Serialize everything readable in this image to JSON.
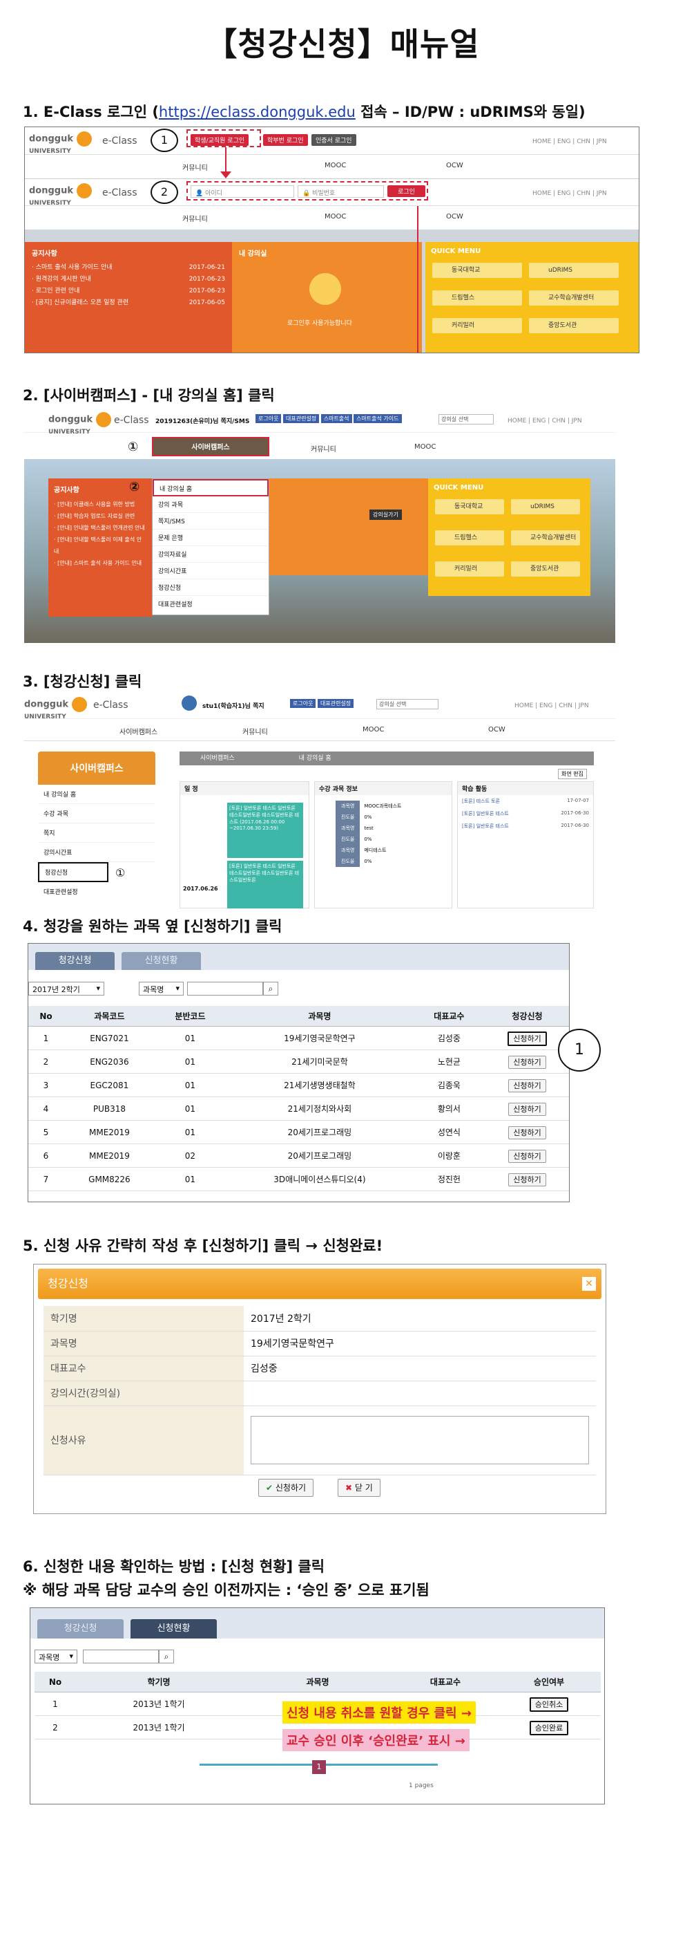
{
  "doc_title": "【청강신청】매뉴얼",
  "steps": {
    "s1_prefix": "1. E-Class 로그인 (",
    "s1_link": "https://eclass.dongguk.edu",
    "s1_suffix": " 접속 – ID/PW : uDRIMS와 동일)",
    "s2": "2. [사이버캠퍼스] - [내 강의실 홈] 클릭",
    "s3": "3. [청강신청] 클릭",
    "s4": "4. 청강을 원하는 과목 옆 [신청하기] 클릭",
    "s5_prefix": "5. 신청 사유 간략히 작성 후 [신청하기] 클릭 → ",
    "s5_bold": "신청완료!",
    "s6a": "6. 신청한 내용 확인하는 방법 : [신청 현황] 클릭",
    "s6b": "※ 해당 과목 담당 교수의 승인 이전까지는 : ‘승인 중’ 으로 표기됨"
  },
  "brand": {
    "logo_top": "dongguk",
    "logo_bottom": "UNIVERSITY",
    "eclass": "e-Class"
  },
  "topnav": "HOME  |  ENG  |  CHN  |  JPN",
  "shot1": {
    "login_buttons": [
      "학생/교직원 로그인",
      "학부번 로그인",
      "인증서 로그인"
    ],
    "id_placeholder": "아이디",
    "pw_placeholder": "비밀번호",
    "login_btn": "로그인",
    "menu": [
      "커뮤니티",
      "MOOC",
      "OCW"
    ],
    "notice_title": "공지사항",
    "notices": [
      "· 스마트 출석 사용 가이드 안내",
      "· 원격강의 게시판 안내",
      "· 로그인 관련 안내",
      "· [공지] 신규이클래스 오픈 일정 관련"
    ],
    "notice_dates": [
      "2017-06-21",
      "2017-06-23",
      "2017-06-23",
      "2017-06-05"
    ],
    "myclass_title": "내 강의실",
    "myclass_msg": "로그인후 사용가능합니다",
    "quick_title": "QUICK MENU",
    "quick_items": [
      "동국대학교",
      "uDRIMS",
      "드림헬스",
      "교수학습개발센터",
      "커리밀러",
      "중앙도서관"
    ],
    "callouts": [
      "1",
      "2"
    ]
  },
  "shot2": {
    "user_info": "20191263(손유미)님  쪽지/SMS",
    "top_buttons": [
      "로그아웃",
      "대표관련설정",
      "스마트출석",
      "스마트출석 가이드"
    ],
    "select": "강의실 선택",
    "menu": [
      "사이버캠퍼스",
      "커뮤니티",
      "MOOC"
    ],
    "dropdown": [
      "내 강의실 홈",
      "강의 과목",
      "쪽지/SMS",
      "문제 은행",
      "강의자료실",
      "강의시간표",
      "청강신청",
      "대표관련설정"
    ],
    "notice_title": "공지사항",
    "notices": [
      "· [안내] 이클래스 사용을 위한 방법",
      "· [안내] 학습자 업로드 자료실 관련",
      "· [안내] 안내할 택스풀러 연개관련 안내",
      "· [안내] 안내할 택스풀러 이제 출석 안내",
      "· [안내] 스마트 출석 사용 가이드 안내"
    ],
    "quick_title": "QUICK MENU",
    "quick_items": [
      "동국대학교",
      "uDRIMS",
      "드림헬스",
      "교수학습개발센터",
      "커리밀러",
      "중앙도서관"
    ],
    "class_btn": "강의실가기",
    "circles": [
      "①",
      "②"
    ]
  },
  "shot3": {
    "user_info": "stu1(학습자1)님  쪽지",
    "top_buttons": [
      "로그아웃",
      "대표관련설정"
    ],
    "select": "강의실 선택",
    "menu": [
      "사이버캠퍼스",
      "커뮤니티",
      "MOOC",
      "OCW"
    ],
    "side_title": "사이버캠퍼스",
    "side_items": [
      "내 강의실 홈",
      "수강 과목",
      "쪽지",
      "강의시간표",
      "청강신청",
      "대표관련설정"
    ],
    "crumb": [
      "사이버캠퍼스",
      "내 강의실 홈"
    ],
    "edit_btn": "화면 편집",
    "panels": [
      "일 정",
      "수강 과목 정보",
      "학습 활동"
    ],
    "schedule_date": "2017.06.26",
    "schedule_cards": [
      "[토론] 일반토론 테스트 일반토론 테스트일반토론 테스트일반토론 테스트 (2017.06.26 00:00 ~2017.06.30 23:59)",
      "[토론] 일반토론 테스트 일반토론 테스트일반토론 테스트일반토론 테스트일반토론"
    ],
    "course_rows": [
      [
        "과목명",
        "MOOC과목테스트"
      ],
      [
        "진도율",
        "0%"
      ],
      [
        "과목명",
        "test"
      ],
      [
        "진도율",
        "0%"
      ],
      [
        "과목명",
        "메디테스트"
      ],
      [
        "진도율",
        "0%"
      ]
    ],
    "activity": [
      [
        "[토론] 테스트 토론",
        "17-07-07"
      ],
      [
        "[토론] 일반토론 테스트",
        "2017-06-30"
      ],
      [
        "[토론] 일반토론 테스트",
        "2017-06-30"
      ]
    ],
    "circle": "①"
  },
  "shot4": {
    "tabs": [
      "청강신청",
      "신청현황"
    ],
    "semester": "2017년 2학기",
    "search_field": "과목명",
    "headers": [
      "No",
      "과목코드",
      "분반코드",
      "과목명",
      "대표교수",
      "청강신청"
    ],
    "rows": [
      [
        "1",
        "ENG7021",
        "01",
        "19세기영국문학연구",
        "김성중"
      ],
      [
        "2",
        "ENG2036",
        "01",
        "21세기미국문학",
        "노현균"
      ],
      [
        "3",
        "EGC2081",
        "01",
        "21세기생명생태철학",
        "김종욱"
      ],
      [
        "4",
        "PUB318",
        "01",
        "21세기정치와사회",
        "황의서"
      ],
      [
        "5",
        "MME2019",
        "01",
        "20세기프로그래밍",
        "성연식"
      ],
      [
        "6",
        "MME2019",
        "02",
        "20세기프로그래밍",
        "이랑훈"
      ],
      [
        "7",
        "GMM8226",
        "01",
        "3D애니메이션스튜디오(4)",
        "정진헌"
      ]
    ],
    "apply_btn": "신청하기",
    "circle": "1"
  },
  "shot5": {
    "dialog_title": "청강신청",
    "labels": [
      "학기명",
      "과목명",
      "대표교수",
      "강의시간(강의실)",
      "신청사유"
    ],
    "values": [
      "2017년 2학기",
      "19세기영국문학연구",
      "김성중",
      ""
    ],
    "submit": "신청하기",
    "close": "닫 기"
  },
  "shot6": {
    "tabs": [
      "청강신청",
      "신청현황"
    ],
    "search_field": "과목명",
    "headers": [
      "No",
      "학기명",
      "과목명",
      "대표교수",
      "승인여부"
    ],
    "rows": [
      [
        "1",
        "2013년 1학기",
        "승인취소"
      ],
      [
        "2",
        "2013년 1학기",
        "승인완료"
      ]
    ],
    "note_cancel": "신청 내용 취소를 원할 경우 클릭 →",
    "note_done": "교수 승인 이후 ‘승인완료’ 표시 →",
    "page": "1",
    "pages": "1 pages"
  }
}
